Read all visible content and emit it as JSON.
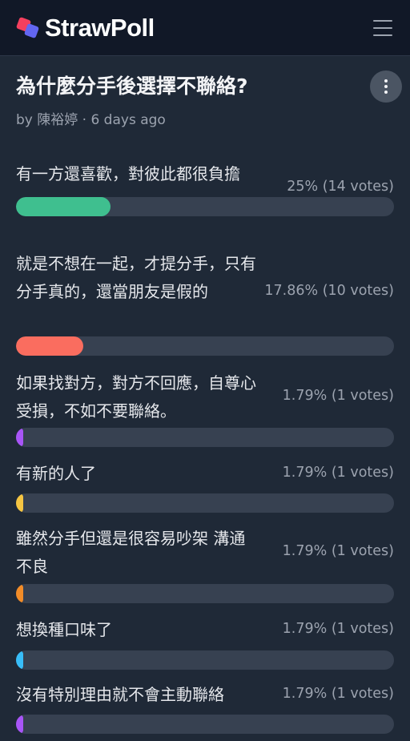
{
  "app": {
    "name": "StrawPoll"
  },
  "poll": {
    "title": "為什麼分手後選擇不聯絡?",
    "byline": "by 陳裕婷 · 6 days ago"
  },
  "options": [
    {
      "label": "有一方還喜歡，對彼此都很負擔",
      "stat": "25% (14 votes)",
      "percent": 25,
      "color": "#3fbf8f"
    },
    {
      "label": "就是不想在一起，才提分手，只有分手真的，還當朋友是假的",
      "stat": "17.86% (10 votes)",
      "percent": 17.86,
      "color": "#fa6d5f"
    },
    {
      "label": "如果找對方，對方不回應，自尊心受損，不如不要聯絡。",
      "stat": "1.79% (1 votes)",
      "percent": 1.79,
      "color": "#a855f7"
    },
    {
      "label": "有新的人了",
      "stat": "1.79% (1 votes)",
      "percent": 1.79,
      "color": "#f5c542"
    },
    {
      "label": "雖然分手但還是很容易吵架 溝通不良",
      "stat": "1.79% (1 votes)",
      "percent": 1.79,
      "color": "#f28c28"
    },
    {
      "label": "想換種口味了",
      "stat": "1.79% (1 votes)",
      "percent": 1.79,
      "color": "#38bdf8"
    },
    {
      "label": "沒有特別理由就不會主動聯絡",
      "stat": "1.79% (1 votes)",
      "percent": 1.79,
      "color": "#a855f7"
    }
  ]
}
